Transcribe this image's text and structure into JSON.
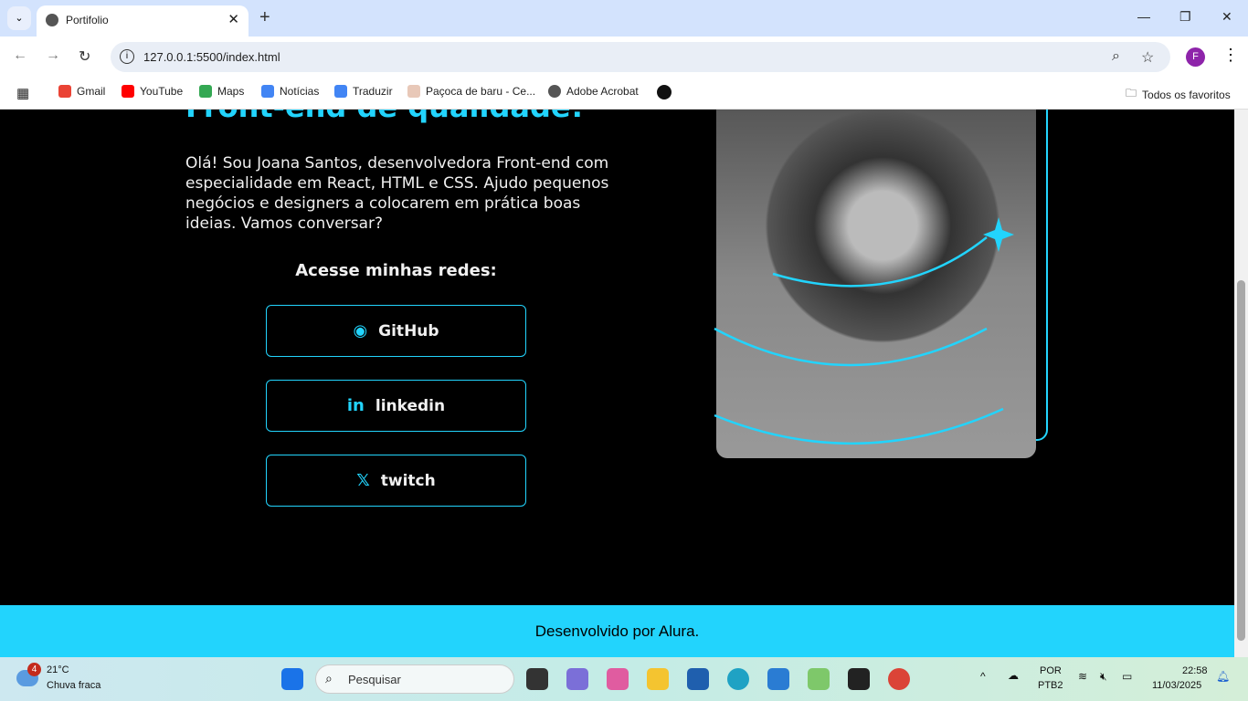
{
  "browser": {
    "tab_title": "Portifolio",
    "url": "127.0.0.1:5500/index.html",
    "profile_initial": "F",
    "bookmarks": [
      "Gmail",
      "YouTube",
      "Maps",
      "Notícias",
      "Traduzir",
      "Paçoca de baru - Ce...",
      "Adobe Acrobat"
    ],
    "all_bookmarks": "Todos os favoritos"
  },
  "page": {
    "heading": "Front-end de qualidade!",
    "intro": "Olá! Sou Joana Santos, desenvolvedora Front-end com especialidade em React, HTML e CSS. Ajudo pequenos negócios e designers a colocarem em prática boas ideias. Vamos conversar?",
    "social_title": "Acesse minhas redes:",
    "links": [
      {
        "label": "GitHub",
        "icon": "github-icon"
      },
      {
        "label": "linkedin",
        "icon": "linkedin-icon"
      },
      {
        "label": "twitch",
        "icon": "x-icon"
      }
    ],
    "footer": "Desenvolvido por Alura.",
    "accent": "#22d4fd"
  },
  "taskbar": {
    "weather_temp": "21°C",
    "weather_desc": "Chuva fraca",
    "weather_badge": "4",
    "search": "Pesquisar",
    "lang1": "POR",
    "lang2": "PTB2",
    "time": "22:58",
    "date": "11/03/2025"
  }
}
